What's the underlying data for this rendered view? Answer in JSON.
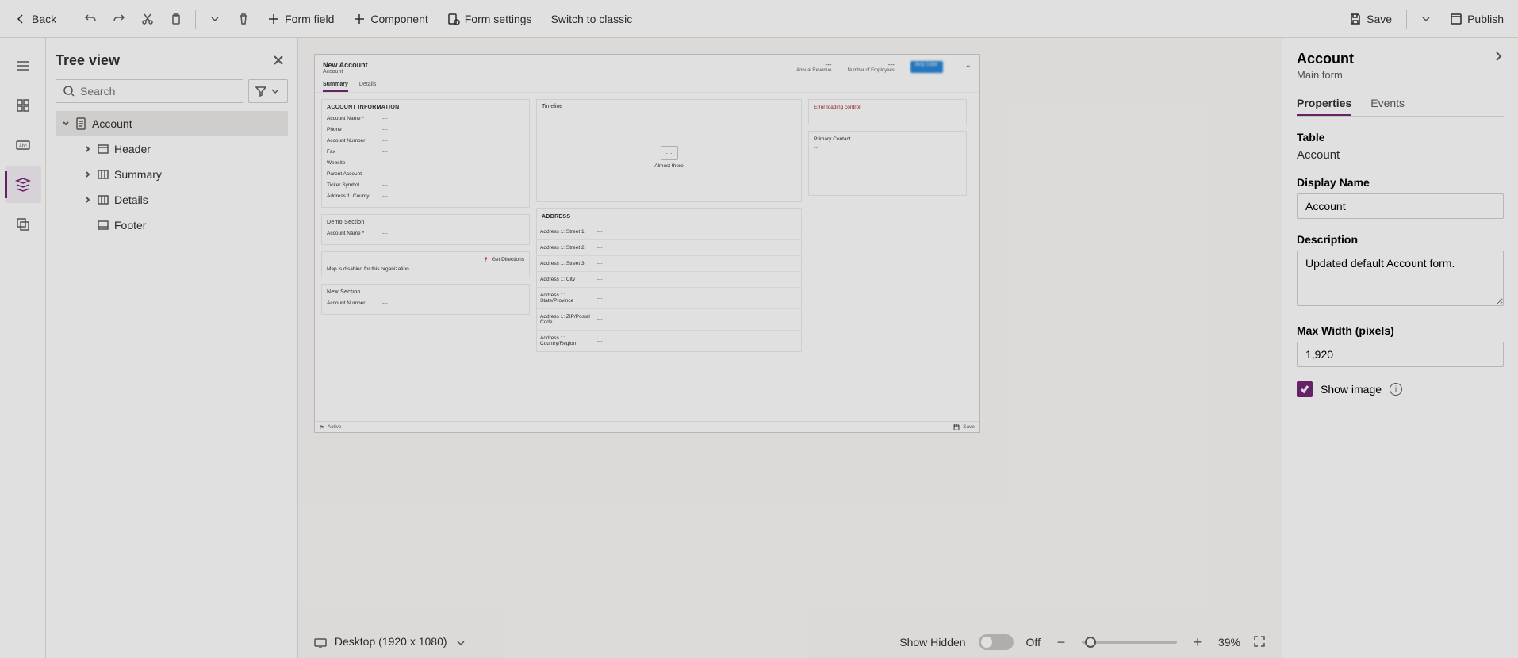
{
  "toolbar": {
    "back": "Back",
    "form_field": "Form field",
    "component": "Component",
    "form_settings": "Form settings",
    "switch_classic": "Switch to classic",
    "save": "Save",
    "publish": "Publish"
  },
  "tree": {
    "title": "Tree view",
    "search_placeholder": "Search",
    "items": [
      {
        "label": "Account"
      },
      {
        "label": "Header"
      },
      {
        "label": "Summary"
      },
      {
        "label": "Details"
      },
      {
        "label": "Footer"
      }
    ]
  },
  "preview": {
    "header": {
      "title": "New Account",
      "subtitle": "Account",
      "right": [
        {
          "value": "---",
          "label": "Annual Revenue"
        },
        {
          "value": "---",
          "label": "Number of Employees"
        }
      ],
      "pill": "Any User"
    },
    "tabs": [
      "Summary",
      "Details"
    ],
    "account_info": {
      "title": "ACCOUNT INFORMATION",
      "rows": [
        {
          "label": "Account Name",
          "required": true,
          "value": "---"
        },
        {
          "label": "Phone",
          "value": "---"
        },
        {
          "label": "Account Number",
          "value": "---"
        },
        {
          "label": "Fax",
          "value": "---"
        },
        {
          "label": "Website",
          "value": "---"
        },
        {
          "label": "Parent Account",
          "value": "---"
        },
        {
          "label": "Ticker Symbol",
          "value": "---"
        },
        {
          "label": "Address 1: County",
          "value": "---"
        }
      ]
    },
    "demo": {
      "title": "Demo Section",
      "rows": [
        {
          "label": "Account Name",
          "required": true,
          "value": "---"
        }
      ]
    },
    "map": {
      "link": "Get Directions",
      "text": "Map is disabled for this organization."
    },
    "new_section": {
      "title": "New Section",
      "rows": [
        {
          "label": "Account Number",
          "value": "---"
        }
      ]
    },
    "timeline": {
      "title": "Timeline",
      "status": "Almost there"
    },
    "address": {
      "title": "ADDRESS",
      "rows": [
        {
          "label": "Address 1: Street 1",
          "value": "---"
        },
        {
          "label": "Address 1: Street 2",
          "value": "---"
        },
        {
          "label": "Address 1: Street 3",
          "value": "---"
        },
        {
          "label": "Address 1: City",
          "value": "---"
        },
        {
          "label": "Address 1: State/Province",
          "value": "---"
        },
        {
          "label": "Address 1: ZIP/Postal Code",
          "value": "---"
        },
        {
          "label": "Address 1: Country/Region",
          "value": "---"
        }
      ]
    },
    "error": "Error loading control",
    "primary_contact": {
      "title": "Primary Contact",
      "value": "---"
    },
    "footer": {
      "status": "Active",
      "save": "Save"
    }
  },
  "status": {
    "device": "Desktop (1920 x 1080)",
    "show_hidden": "Show Hidden",
    "toggle": "Off",
    "zoom": "39%"
  },
  "props": {
    "title": "Account",
    "subtitle": "Main form",
    "tabs": {
      "properties": "Properties",
      "events": "Events"
    },
    "table_label": "Table",
    "table_value": "Account",
    "display_name_label": "Display Name",
    "display_name_value": "Account",
    "description_label": "Description",
    "description_value": "Updated default Account form.",
    "maxwidth_label": "Max Width (pixels)",
    "maxwidth_value": "1,920",
    "show_image": "Show image"
  }
}
